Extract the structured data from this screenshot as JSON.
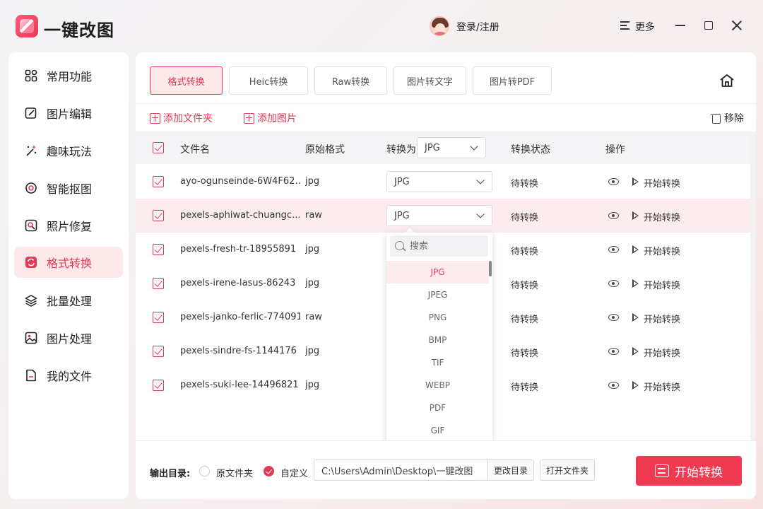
{
  "app": {
    "title": "一键改图",
    "login": "登录/注册",
    "more": "更多"
  },
  "sidebar": {
    "items": [
      {
        "label": "常用功能",
        "icon": "grid-icon"
      },
      {
        "label": "图片编辑",
        "icon": "edit-icon"
      },
      {
        "label": "趣味玩法",
        "icon": "magic-icon"
      },
      {
        "label": "智能抠图",
        "icon": "target-icon"
      },
      {
        "label": "照片修复",
        "icon": "repair-icon"
      },
      {
        "label": "格式转换",
        "icon": "convert-icon",
        "active": true
      },
      {
        "label": "批量处理",
        "icon": "layers-icon"
      },
      {
        "label": "图片处理",
        "icon": "image-icon"
      },
      {
        "label": "我的文件",
        "icon": "file-icon"
      }
    ]
  },
  "tabs": [
    "格式转换",
    "Heic转换",
    "Raw转换",
    "图片转文字",
    "图片转PDF"
  ],
  "actions": {
    "add_folder": "添加文件夹",
    "add_image": "添加图片",
    "remove": "移除"
  },
  "table": {
    "headers": {
      "name": "文件名",
      "format": "原始格式",
      "convert_to": "转换为",
      "status": "转换状态",
      "ops": "操作"
    },
    "global_format": "JPG",
    "rows": [
      {
        "name": "ayo-ogunseinde-6W4F62...",
        "format": "jpg",
        "target": "JPG",
        "status": "待转换",
        "action": "开始转换"
      },
      {
        "name": "pexels-aphiwat-chuangc...",
        "format": "raw",
        "target": "JPG",
        "status": "待转换",
        "action": "开始转换"
      },
      {
        "name": "pexels-fresh-tr-18955891",
        "format": "jpg",
        "target": "",
        "status": "待转换",
        "action": "开始转换"
      },
      {
        "name": "pexels-irene-lasus-86243",
        "format": "jpg",
        "target": "",
        "status": "待转换",
        "action": "开始转换"
      },
      {
        "name": "pexels-janko-ferlic-774091",
        "format": "raw",
        "target": "",
        "status": "待转换",
        "action": "开始转换"
      },
      {
        "name": "pexels-sindre-fs-1144176",
        "format": "jpg",
        "target": "",
        "status": "待转换",
        "action": "开始转换"
      },
      {
        "name": "pexels-suki-lee-14496821",
        "format": "jpg",
        "target": "",
        "status": "待转换",
        "action": "开始转换"
      }
    ]
  },
  "dropdown": {
    "placeholder": "搜索",
    "options": [
      "JPG",
      "JPEG",
      "PNG",
      "BMP",
      "TIF",
      "WEBP",
      "PDF",
      "GIF"
    ],
    "selected": "JPG"
  },
  "footer": {
    "label": "输出目录:",
    "option_original": "原文件夹",
    "option_custom": "自定义",
    "path": "C:\\Users\\Admin\\Desktop\\一键改图",
    "change_dir": "更改目录",
    "open_folder": "打开文件夹",
    "start": "开始转换"
  }
}
